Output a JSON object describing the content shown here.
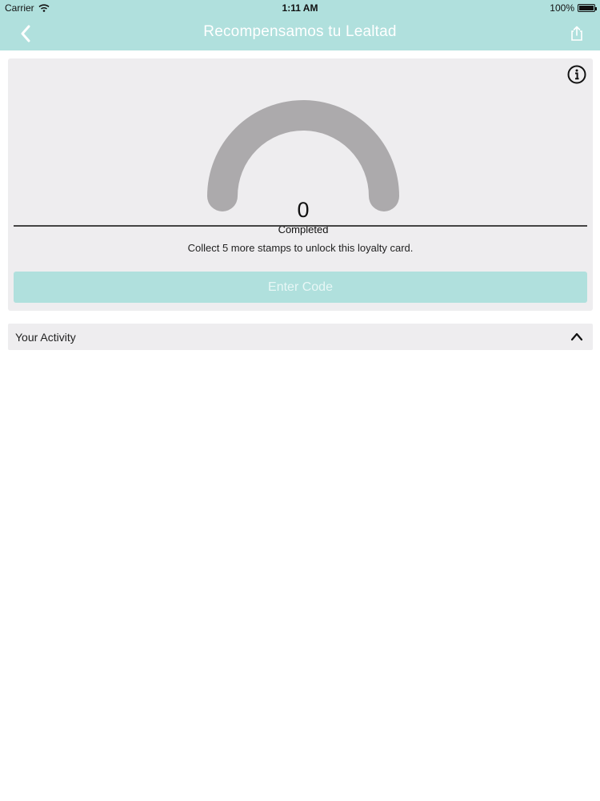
{
  "status_bar": {
    "carrier": "Carrier",
    "time": "1:11 AM",
    "battery": "100%"
  },
  "nav": {
    "title": "Recompensamos tu Lealtad",
    "back_icon": "chevron-left-icon",
    "share_icon": "share-icon"
  },
  "loyalty_card": {
    "completed_count": "0",
    "completed_label": "Completed",
    "message": "Collect 5 more stamps to unlock this loyalty card.",
    "enter_code_label": "Enter Code",
    "info_icon": "info-icon"
  },
  "activity": {
    "label": "Your Activity",
    "chevron_icon": "chevron-up-icon"
  },
  "colors": {
    "accent": "#b0e0dd",
    "card_bg": "#eeedef",
    "gauge": "#acaaac"
  }
}
